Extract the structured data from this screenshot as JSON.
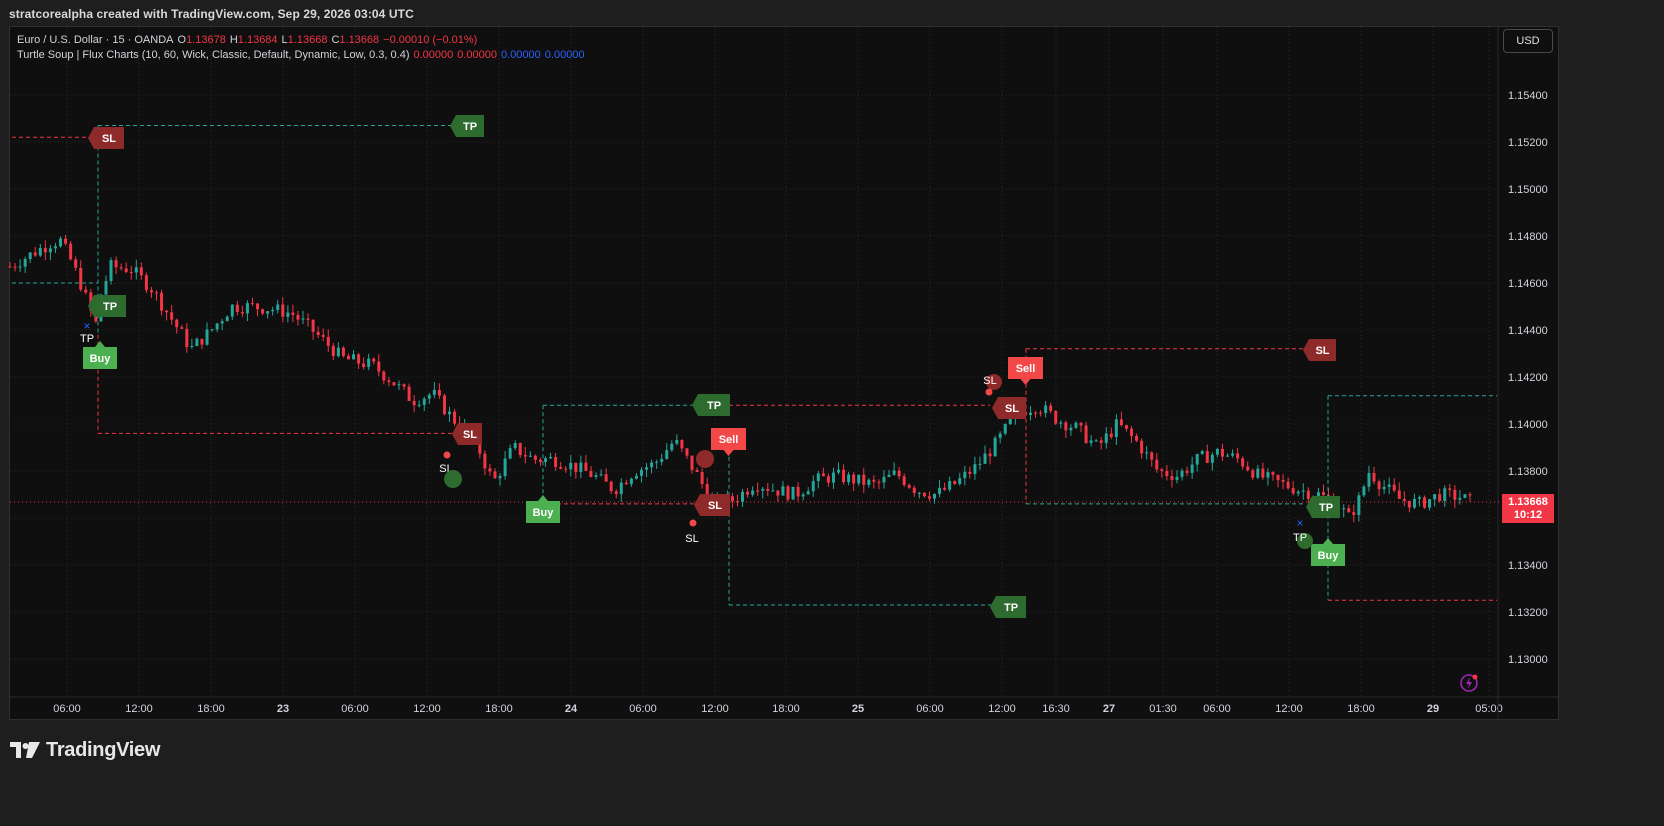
{
  "header": {
    "title": "stratcorealpha created with TradingView.com, Sep 29, 2026 03:04 UTC"
  },
  "legend": {
    "symbol": "Euro / U.S. Dollar · 15 · OANDA",
    "ohlc": [
      {
        "label": "O",
        "value": "1.13678"
      },
      {
        "label": "H",
        "value": "1.13684"
      },
      {
        "label": "L",
        "value": "1.13668"
      },
      {
        "label": "C",
        "value": "1.13668"
      }
    ],
    "change": "−0.00010 (−0.01%)",
    "indicator": "Turtle Soup | Flux Charts (10, 60, Wick, Classic, Default, Dynamic, Low, 0.3, 0.4)",
    "indicator_values": [
      {
        "value": "0.00000",
        "color": "#f23645"
      },
      {
        "value": "0.00000",
        "color": "#f23645"
      },
      {
        "value": "0.00000",
        "color": "#2962ff"
      },
      {
        "value": "0.00000",
        "color": "#2962ff"
      }
    ]
  },
  "currency_button": "USD",
  "last_price": {
    "price": "1.13668",
    "countdown": "10:12"
  },
  "colors": {
    "up": "#26a69a",
    "down": "#f23645",
    "tp_label": "#2e6b2e",
    "sl_label": "#8e2a2a",
    "buy_label": "#4caf50",
    "sell_label": "#f24848",
    "grid": "#2a2a2a"
  },
  "footer": {
    "brand": "TradingView"
  },
  "chart_data": {
    "type": "candlestick",
    "title": "Euro / U.S. Dollar · 15 · OANDA",
    "y_axis": {
      "ticks": [
        "1.15400",
        "1.15200",
        "1.15000",
        "1.14800",
        "1.14600",
        "1.14400",
        "1.14200",
        "1.14000",
        "1.13800",
        "1.13600",
        "1.13400",
        "1.13200",
        "1.13000"
      ],
      "range": [
        1.1292,
        1.1558
      ]
    },
    "x_axis": {
      "ticks": [
        "06:00",
        "12:00",
        "18:00",
        "23",
        "06:00",
        "12:00",
        "18:00",
        "24",
        "06:00",
        "12:00",
        "18:00",
        "25",
        "06:00",
        "12:00",
        "16:30",
        "27",
        "01:30",
        "06:00",
        "12:00",
        "18:00",
        "29",
        "05:00"
      ]
    },
    "price_path": [
      {
        "t": 0,
        "price": 1.1467
      },
      {
        "t": 2,
        "price": 1.1472
      },
      {
        "t": 4,
        "price": 1.1477
      },
      {
        "t": 5,
        "price": 1.1478
      },
      {
        "t": 6,
        "price": 1.147
      },
      {
        "t": 7,
        "price": 1.146
      },
      {
        "t": 8.5,
        "price": 1.1442
      },
      {
        "t": 9,
        "price": 1.1455
      },
      {
        "t": 10,
        "price": 1.1467
      },
      {
        "t": 12,
        "price": 1.1466
      },
      {
        "t": 14,
        "price": 1.1458
      },
      {
        "t": 16,
        "price": 1.1445
      },
      {
        "t": 18,
        "price": 1.1432
      },
      {
        "t": 20,
        "price": 1.144
      },
      {
        "t": 22,
        "price": 1.145
      },
      {
        "t": 24,
        "price": 1.145
      },
      {
        "t": 26,
        "price": 1.1449
      },
      {
        "t": 28,
        "price": 1.1447
      },
      {
        "t": 30,
        "price": 1.144
      },
      {
        "t": 33,
        "price": 1.1428
      },
      {
        "t": 36,
        "price": 1.1425
      },
      {
        "t": 38,
        "price": 1.1418
      },
      {
        "t": 40,
        "price": 1.141
      },
      {
        "t": 42,
        "price": 1.1413
      },
      {
        "t": 44,
        "price": 1.1402
      },
      {
        "t": 46,
        "price": 1.1395
      },
      {
        "t": 48,
        "price": 1.1375
      },
      {
        "t": 50,
        "price": 1.139
      },
      {
        "t": 52,
        "price": 1.1385
      },
      {
        "t": 54,
        "price": 1.1385
      },
      {
        "t": 56,
        "price": 1.1382
      },
      {
        "t": 58,
        "price": 1.1378
      },
      {
        "t": 60,
        "price": 1.1372
      },
      {
        "t": 62,
        "price": 1.138
      },
      {
        "t": 64,
        "price": 1.1383
      },
      {
        "t": 66,
        "price": 1.1393
      },
      {
        "t": 68,
        "price": 1.138
      },
      {
        "t": 70,
        "price": 1.1365
      },
      {
        "t": 72,
        "price": 1.1368
      },
      {
        "t": 74,
        "price": 1.1375
      },
      {
        "t": 76,
        "price": 1.1372
      },
      {
        "t": 78,
        "price": 1.137
      },
      {
        "t": 80,
        "price": 1.1376
      },
      {
        "t": 82,
        "price": 1.1378
      },
      {
        "t": 84,
        "price": 1.1376
      },
      {
        "t": 86,
        "price": 1.1374
      },
      {
        "t": 88,
        "price": 1.1379
      },
      {
        "t": 90,
        "price": 1.1372
      },
      {
        "t": 92,
        "price": 1.137
      },
      {
        "t": 94,
        "price": 1.1375
      },
      {
        "t": 96,
        "price": 1.1382
      },
      {
        "t": 98,
        "price": 1.1392
      },
      {
        "t": 100,
        "price": 1.1405
      },
      {
        "t": 102,
        "price": 1.1408
      },
      {
        "t": 104,
        "price": 1.1402
      },
      {
        "t": 106,
        "price": 1.1398
      },
      {
        "t": 108,
        "price": 1.139
      },
      {
        "t": 110,
        "price": 1.14
      },
      {
        "t": 112,
        "price": 1.1392
      },
      {
        "t": 114,
        "price": 1.138
      },
      {
        "t": 116,
        "price": 1.1378
      },
      {
        "t": 118,
        "price": 1.1385
      },
      {
        "t": 120,
        "price": 1.1388
      },
      {
        "t": 122,
        "price": 1.1385
      },
      {
        "t": 124,
        "price": 1.1378
      },
      {
        "t": 126,
        "price": 1.1375
      },
      {
        "t": 128,
        "price": 1.1372
      },
      {
        "t": 130,
        "price": 1.137
      },
      {
        "t": 132,
        "price": 1.1365
      },
      {
        "t": 133,
        "price": 1.136
      },
      {
        "t": 134,
        "price": 1.1368
      },
      {
        "t": 135,
        "price": 1.138
      },
      {
        "t": 136,
        "price": 1.1375
      },
      {
        "t": 138,
        "price": 1.1368
      },
      {
        "t": 140,
        "price": 1.1366
      },
      {
        "t": 142,
        "price": 1.137
      },
      {
        "t": 144,
        "price": 1.1369
      },
      {
        "t": 145,
        "price": 1.1367
      }
    ],
    "signals": [
      {
        "type": "TP",
        "price": 1.1527
      },
      {
        "type": "SL",
        "price": 1.1522
      },
      {
        "type": "TP",
        "price": 1.146
      },
      {
        "type": "Buy",
        "price": 1.1438
      },
      {
        "type": "SL",
        "price": 1.1396
      },
      {
        "type": "TP",
        "price": 1.1408
      },
      {
        "type": "Buy",
        "price": 1.1366
      },
      {
        "type": "Sell",
        "price": 1.1392
      },
      {
        "type": "SL",
        "price": 1.1366
      },
      {
        "type": "TP",
        "price": 1.1323
      },
      {
        "type": "Sell",
        "price": 1.1426
      },
      {
        "type": "SL",
        "price": 1.1408
      },
      {
        "type": "SL",
        "price": 1.1432
      },
      {
        "type": "TP",
        "price": 1.1366
      },
      {
        "type": "Buy",
        "price": 1.1345
      },
      {
        "type": "SL",
        "price": 1.1325
      }
    ],
    "point_labels": [
      "TP",
      "SL",
      "SL",
      "SL",
      "TP"
    ],
    "legend": "top-left",
    "grid": true
  }
}
